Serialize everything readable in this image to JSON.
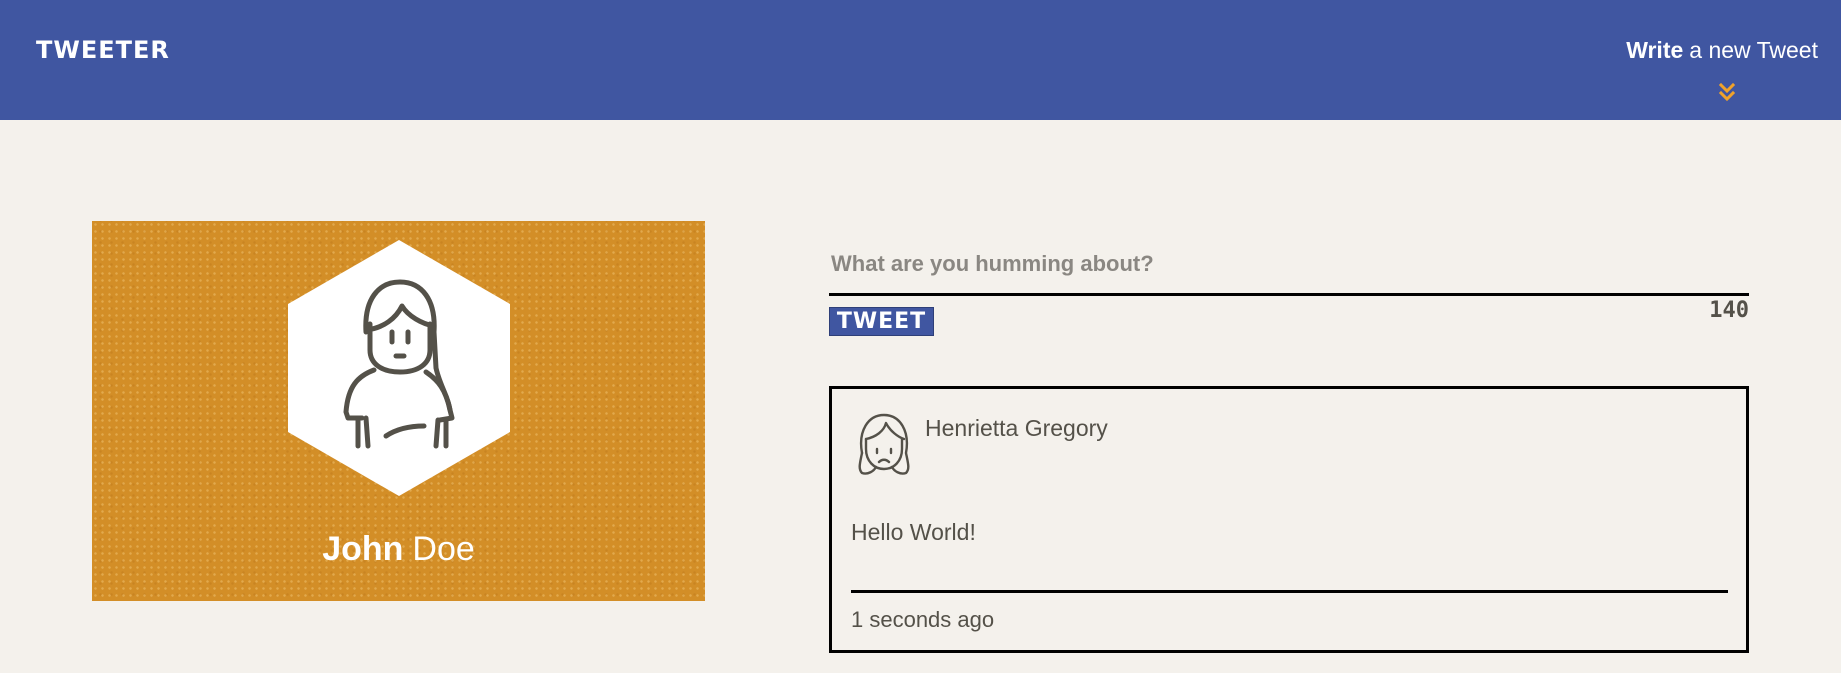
{
  "nav": {
    "brand": "TWEETER",
    "compose_strong": "Write",
    "compose_rest": "a new Tweet",
    "compose_icon": "double-chevron-down-icon",
    "background": "#4056a1",
    "accent": "#f0a22a"
  },
  "profile": {
    "first_name": "John",
    "last_name": "Doe",
    "avatar_icon": "woman-avatar-icon",
    "card_color": "#d38e27"
  },
  "composer": {
    "placeholder": "What are you humming about?",
    "value": "",
    "submit_label": "TWEET",
    "counter": "140"
  },
  "tweets": [
    {
      "user": "Henrietta Gregory",
      "avatar_icon": "girl-face-icon",
      "content": "Hello World!",
      "time": "1 seconds ago"
    }
  ]
}
